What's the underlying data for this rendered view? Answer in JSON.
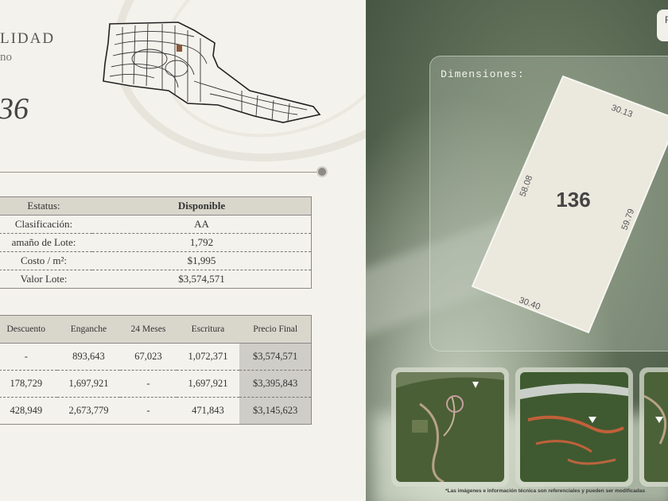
{
  "header": {
    "title": "LIDAD",
    "subtitle": "no",
    "lot_number": "36"
  },
  "info_table": [
    {
      "label": "Estatus:",
      "value": "Disponible"
    },
    {
      "label": "Clasificación:",
      "value": "AA"
    },
    {
      "label": "amaño de Lote:",
      "value": "1,792"
    },
    {
      "label": "Costo / m²:",
      "value": "$1,995"
    },
    {
      "label": "Valor Lote:",
      "value": "$3,574,571"
    }
  ],
  "plans_table": {
    "headers": [
      "Descuento",
      "Enganche",
      "24 Meses",
      "Escritura",
      "Precio Final"
    ],
    "rows": [
      [
        "-",
        "893,643",
        "67,023",
        "1,072,371",
        "$3,574,571"
      ],
      [
        "178,729",
        "1,697,921",
        "-",
        "1,697,921",
        "$3,395,843"
      ],
      [
        "428,949",
        "2,673,779",
        "-",
        "471,843",
        "$3,145,623"
      ]
    ]
  },
  "dimensions": {
    "title": "Dimensiones:",
    "lot_label": "136",
    "top": "30.13",
    "left": "58.08",
    "right": "59.79",
    "bottom": "30.40"
  },
  "corner_button_label": "F",
  "disclaimer": "*Las imágenes e información técnica son referenciales y pueden ser modificadas",
  "colors": {
    "available": "#2e7d32",
    "table_header": "#d9d6cc"
  }
}
